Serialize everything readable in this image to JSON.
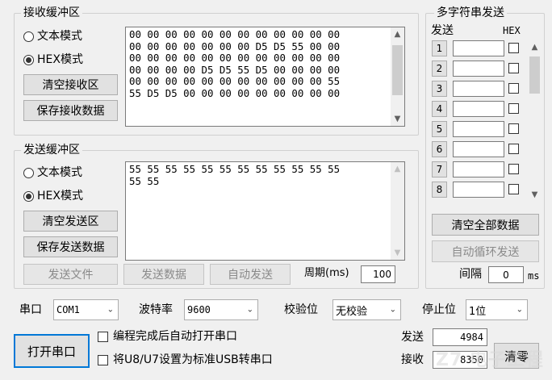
{
  "receive": {
    "title": "接收缓冲区",
    "mode_text": "文本模式",
    "mode_hex": "HEX模式",
    "clear_label": "清空接收区",
    "save_label": "保存接收数据",
    "data": "00 00 00 00 00 00 00 00 00 00 00 00\n00 00 00 00 00 00 00 D5 D5 55 00 00\n00 00 00 00 00 00 00 00 00 00 00 00\n00 00 00 00 D5 D5 55 D5 00 00 00 00\n00 00 00 00 00 00 00 00 00 00 00 55\n55 D5 D5 00 00 00 00 00 00 00 00 00"
  },
  "send": {
    "title": "发送缓冲区",
    "mode_text": "文本模式",
    "mode_hex": "HEX模式",
    "clear_label": "清空发送区",
    "save_label": "保存发送数据",
    "data": "55 55 55 55 55 55 55 55 55 55 55 55\n55 55",
    "send_file": "发送文件",
    "send_data": "发送数据",
    "auto_send": "自动发送",
    "period_label": "周期(ms)",
    "period_value": "100"
  },
  "multi": {
    "title": "多字符串发送",
    "col_send": "发送",
    "col_hex": "HEX",
    "rows": [
      "1",
      "2",
      "3",
      "4",
      "5",
      "6",
      "7",
      "8"
    ],
    "clear_all": "清空全部数据",
    "auto_loop": "自动循环发送",
    "interval_label": "间隔",
    "interval_value": "0",
    "interval_unit": "ms"
  },
  "port": {
    "port_label": "串口",
    "port_value": "COM1",
    "baud_label": "波特率",
    "baud_value": "9600",
    "parity_label": "校验位",
    "parity_value": "无校验",
    "stop_label": "停止位",
    "stop_value": "1位",
    "open_button": "打开串口",
    "auto_open": "编程完成后自动打开串口",
    "usb_setting": "将U8/U7设置为标准USB转串口",
    "sent_label": "发送",
    "sent_value": "4984",
    "recv_label": "接收",
    "recv_value": "8350",
    "clear_label": "清零"
  },
  "watermark": "Z7 电子工程"
}
